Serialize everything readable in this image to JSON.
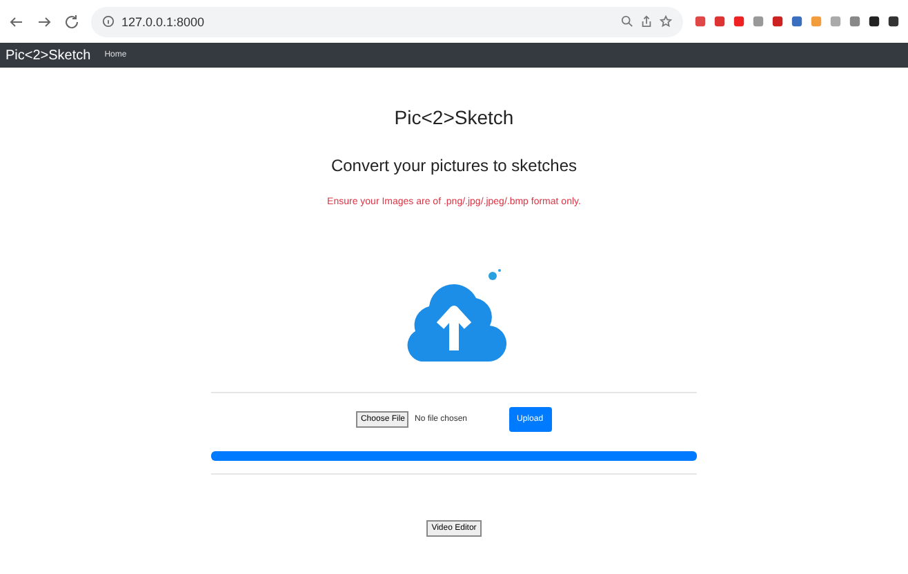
{
  "browser": {
    "url": "127.0.0.1:8000"
  },
  "navbar": {
    "brand": "Pic<2>Sketch",
    "links": [
      "Home"
    ]
  },
  "main": {
    "title": "Pic<2>Sketch",
    "subtitle": "Convert your pictures to sketches",
    "notice": "Ensure your Images are of .png/.jpg/.jpeg/.bmp format only.",
    "file_input": {
      "button": "Choose File",
      "status": "No file chosen"
    },
    "upload_button": "Upload",
    "progress": {
      "level": 1
    },
    "video_button": "Video Editor"
  }
}
